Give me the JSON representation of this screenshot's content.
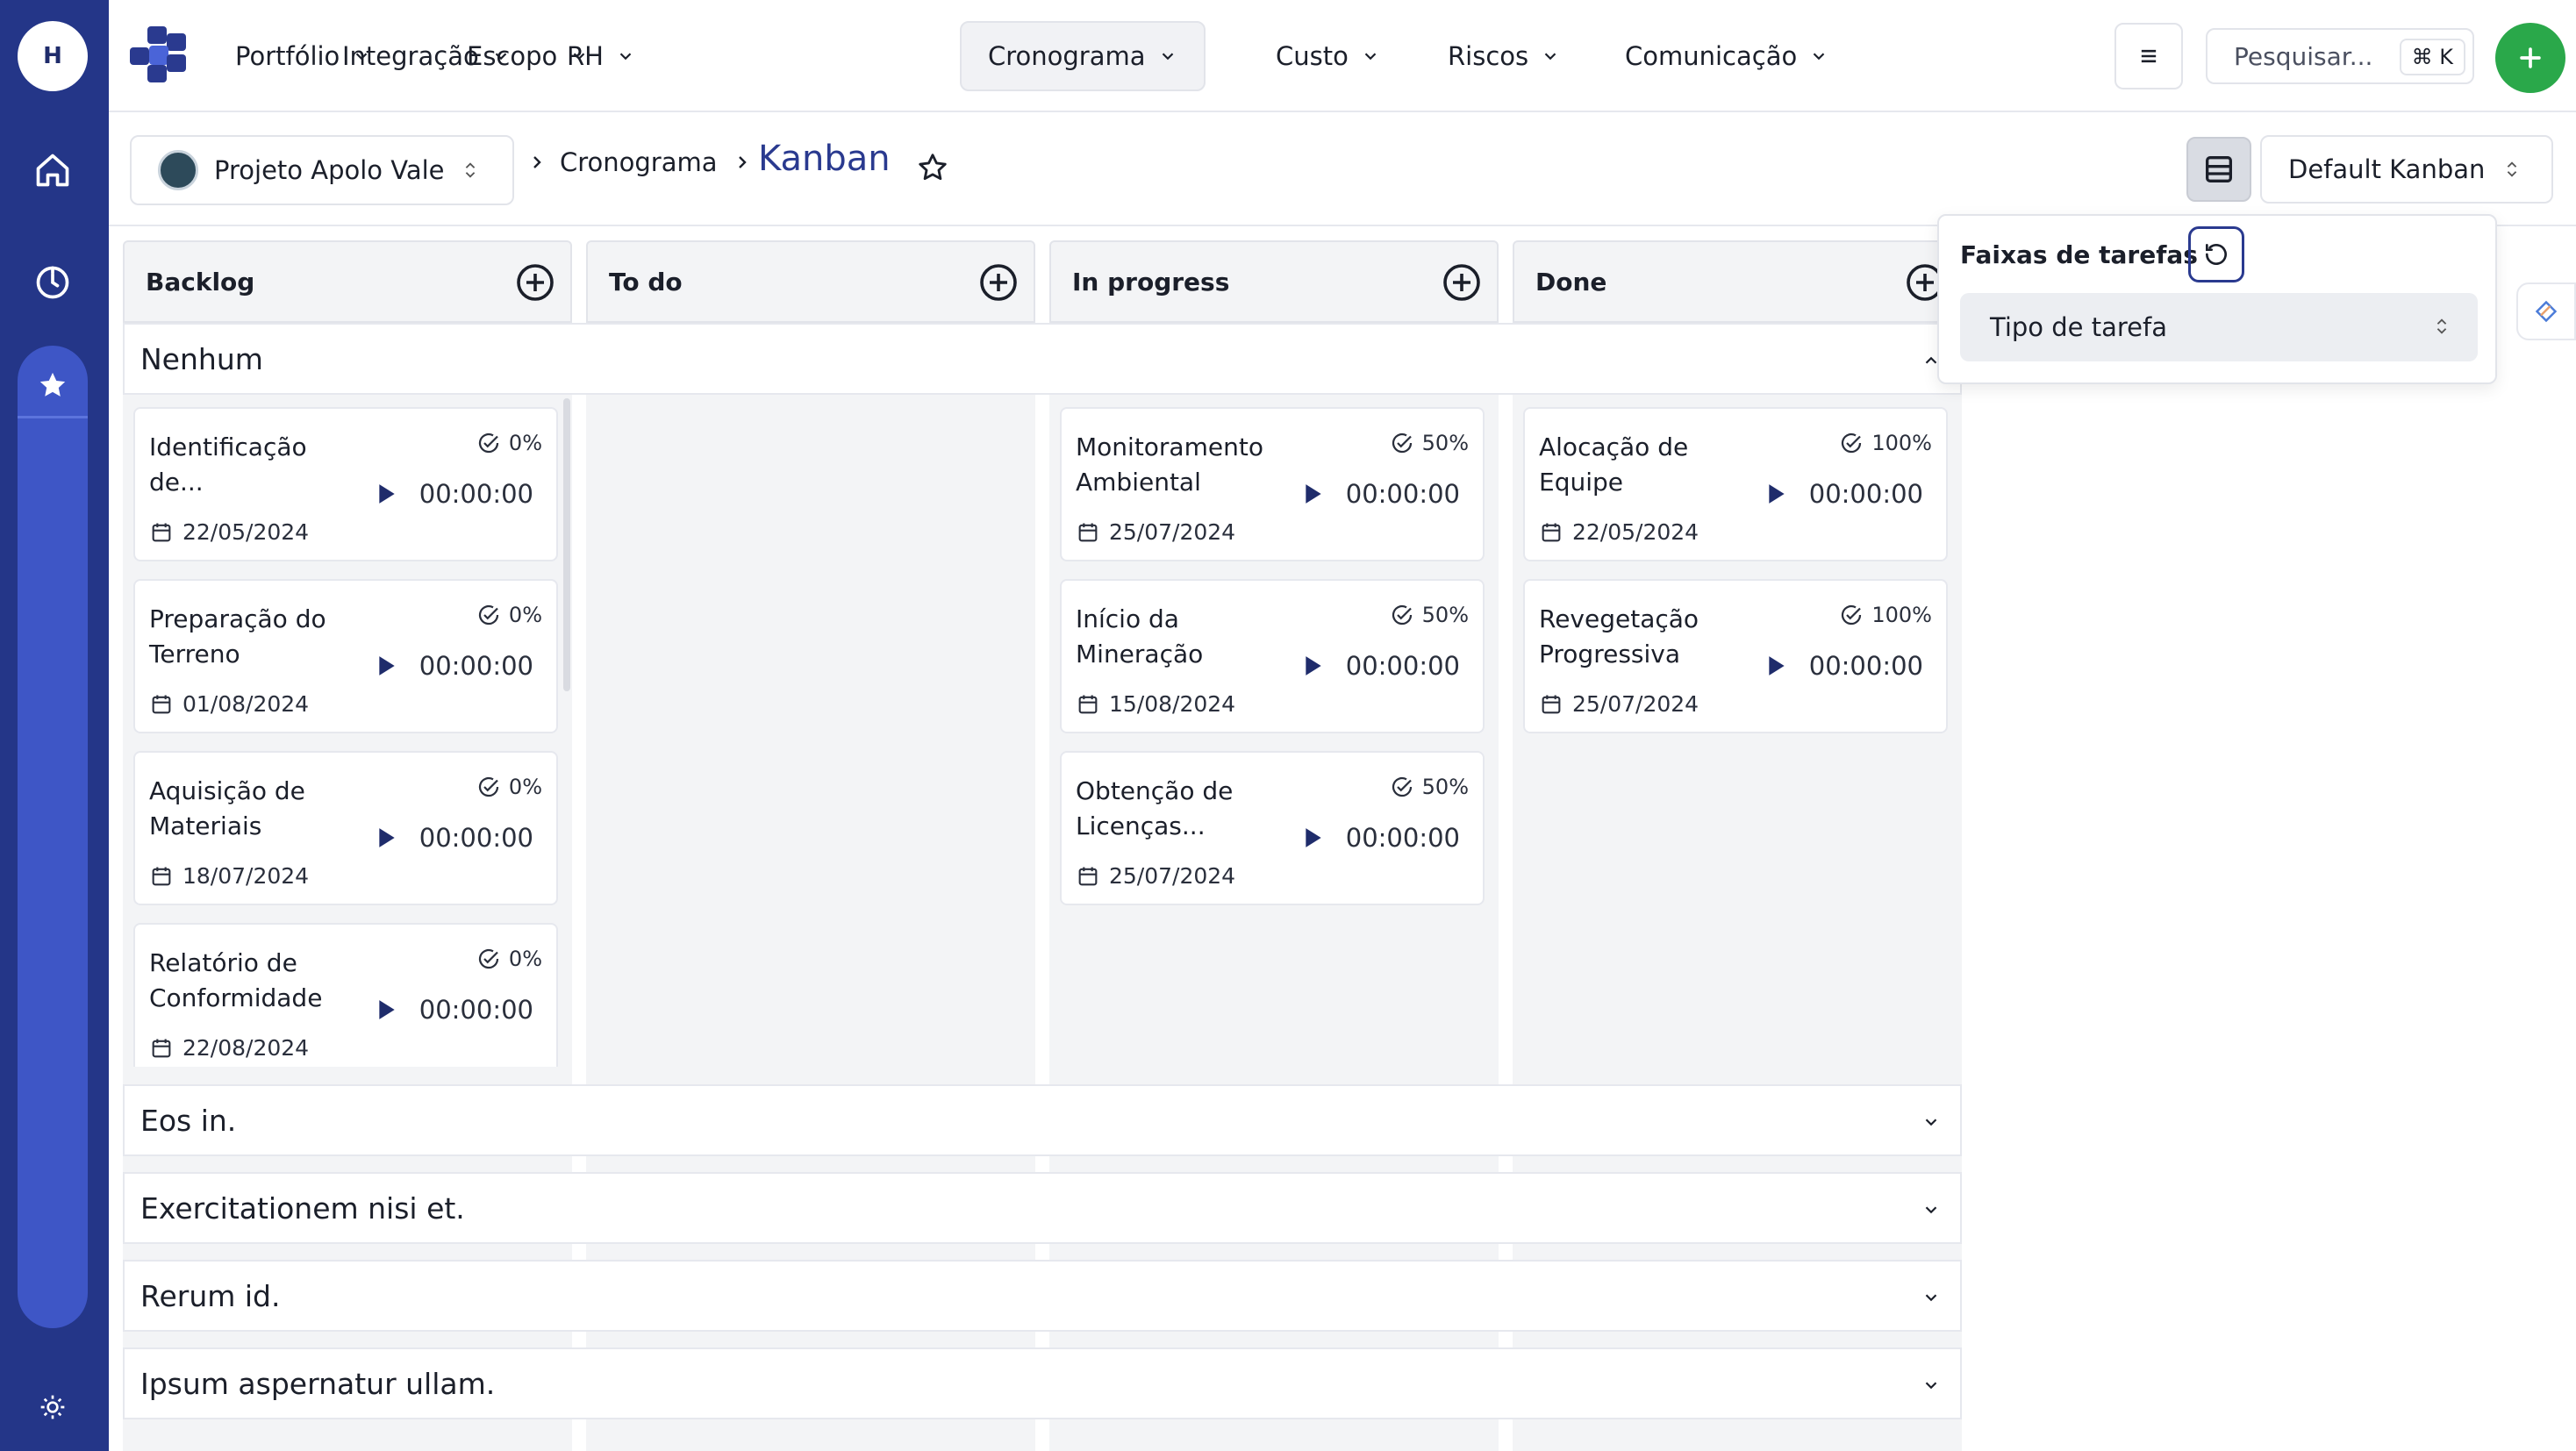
{
  "rail": {
    "avatar_initial": "H"
  },
  "nav": {
    "items": [
      {
        "label": "Portfólio"
      },
      {
        "label": "Integração"
      },
      {
        "label": "Escopo"
      },
      {
        "label": "RH"
      },
      {
        "label": "Cronograma"
      },
      {
        "label": "Custo"
      },
      {
        "label": "Riscos"
      },
      {
        "label": "Comunicação"
      }
    ],
    "active": "Cronograma",
    "search_placeholder": "Pesquisar...",
    "search_shortcut": "⌘ K"
  },
  "breadcrumb": {
    "project": "Projeto Apolo Vale",
    "section": "Cronograma",
    "page": "Kanban",
    "view_select": "Default Kanban"
  },
  "columns": [
    {
      "label": "Backlog"
    },
    {
      "label": "To do"
    },
    {
      "label": "In progress"
    },
    {
      "label": "Done"
    }
  ],
  "lanes": [
    {
      "label": "Nenhum",
      "expanded": true
    },
    {
      "label": "Eos in.",
      "expanded": false
    },
    {
      "label": "Exercitationem nisi et.",
      "expanded": false
    },
    {
      "label": "Rerum id.",
      "expanded": false
    },
    {
      "label": "Ipsum aspernatur ullam.",
      "expanded": false
    }
  ],
  "cards": {
    "backlog": [
      {
        "title": "Identificação de...",
        "progress": "0%",
        "time": "00:00:00",
        "date": "22/05/2024"
      },
      {
        "title": "Preparação do Terreno",
        "progress": "0%",
        "time": "00:00:00",
        "date": "01/08/2024"
      },
      {
        "title": "Aquisição de Materiais",
        "progress": "0%",
        "time": "00:00:00",
        "date": "18/07/2024"
      },
      {
        "title": "Relatório de Conformidade",
        "progress": "0%",
        "time": "00:00:00",
        "date": "22/08/2024"
      }
    ],
    "in_progress": [
      {
        "title": "Monitoramento Ambiental",
        "progress": "50%",
        "time": "00:00:00",
        "date": "25/07/2024"
      },
      {
        "title": "Início da Mineração",
        "progress": "50%",
        "time": "00:00:00",
        "date": "15/08/2024"
      },
      {
        "title": "Obtenção de Licenças...",
        "progress": "50%",
        "time": "00:00:00",
        "date": "25/07/2024"
      }
    ],
    "done": [
      {
        "title": "Alocação de Equipe",
        "progress": "100%",
        "time": "00:00:00",
        "date": "22/05/2024"
      },
      {
        "title": "Revegetação Progressiva",
        "progress": "100%",
        "time": "00:00:00",
        "date": "25/07/2024"
      }
    ]
  },
  "popover": {
    "title": "Faixas de tarefas",
    "select_value": "Tipo de tarefa"
  },
  "colors": {
    "rail": "#243688",
    "accent": "#2a3a8f",
    "play": "#1f2c6b",
    "green": "#2aa84a"
  },
  "icons": [
    "home-icon",
    "history-icon",
    "star-icon",
    "settings-icon",
    "logo-icon",
    "chevron-down-icon",
    "menu-icon",
    "plus-icon",
    "user-avatar",
    "updown-icon",
    "table-view-icon",
    "add-circle-icon",
    "check-circle-icon",
    "play-icon",
    "calendar-icon",
    "reset-icon",
    "side-panel-icon"
  ]
}
